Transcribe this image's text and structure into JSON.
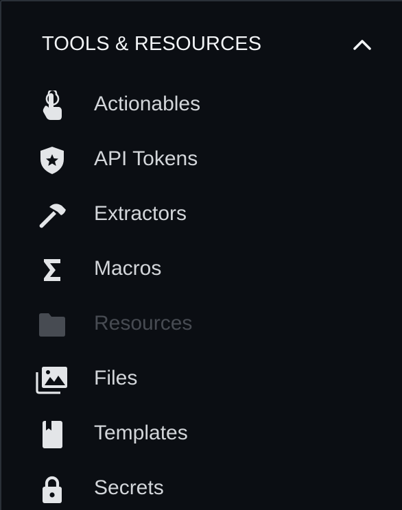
{
  "section": {
    "title": "TOOLS & RESOURCES",
    "expanded": true
  },
  "items": [
    {
      "label": "Actionables",
      "icon": "pointer-hand-icon",
      "enabled": true
    },
    {
      "label": "API Tokens",
      "icon": "shield-star-icon",
      "enabled": true
    },
    {
      "label": "Extractors",
      "icon": "hammer-icon",
      "enabled": true
    },
    {
      "label": "Macros",
      "icon": "sigma-icon",
      "enabled": true
    },
    {
      "label": "Resources",
      "icon": "folder-icon",
      "enabled": false
    },
    {
      "label": "Files",
      "icon": "image-stack-icon",
      "enabled": true
    },
    {
      "label": "Templates",
      "icon": "book-icon",
      "enabled": true
    },
    {
      "label": "Secrets",
      "icon": "lock-icon",
      "enabled": true
    }
  ],
  "colors": {
    "background": "#0b0e13",
    "text": "#d3d6da",
    "icon": "#e3e5e8",
    "disabled": "#474b52",
    "border": "#2a3038"
  }
}
